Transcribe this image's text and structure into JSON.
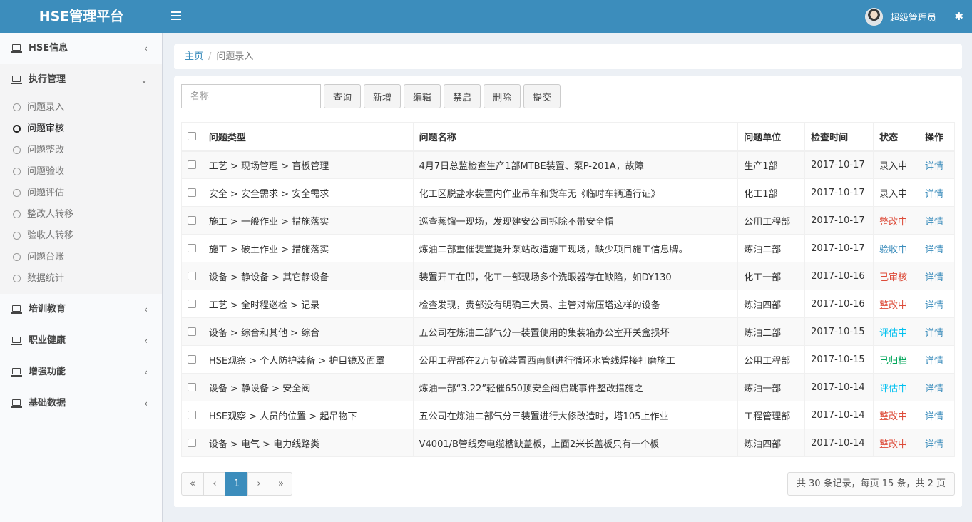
{
  "header": {
    "logo": "HSE管理平台",
    "user_name": "超级管理员"
  },
  "sidebar": {
    "items": [
      {
        "label": "HSE信息",
        "arrow": "‹"
      },
      {
        "label": "执行管理",
        "arrow": "⌄"
      },
      {
        "label": "培训教育",
        "arrow": "‹"
      },
      {
        "label": "职业健康",
        "arrow": "‹"
      },
      {
        "label": "增强功能",
        "arrow": "‹"
      },
      {
        "label": "基础数据",
        "arrow": "‹"
      }
    ],
    "submenu": [
      "问题录入",
      "问题审核",
      "问题整改",
      "问题验收",
      "问题评估",
      "整改人转移",
      "验收人转移",
      "问题台账",
      "数据统计"
    ]
  },
  "breadcrumb": {
    "home": "主页",
    "separator": "/",
    "current": "问题录入"
  },
  "toolbar": {
    "search_placeholder": "名称",
    "buttons": [
      "查询",
      "新增",
      "编辑",
      "禁启",
      "删除",
      "提交"
    ]
  },
  "table": {
    "columns": [
      "问题类型",
      "问题名称",
      "问题单位",
      "检查时间",
      "状态",
      "操作"
    ],
    "rows": [
      {
        "type": "工艺 > 现场管理 > 盲板管理",
        "name": "4月7日总监检查生产1部MTBE装置、泵P-201A，故障",
        "unit": "生产1部",
        "date": "2017-10-17",
        "status": "录入中",
        "status_color": "#333333",
        "action": "详情"
      },
      {
        "type": "安全 > 安全需求 > 安全需求",
        "name": "化工区脱盐水装置内作业吊车和货车无《临时车辆通行证》",
        "unit": "化工1部",
        "date": "2017-10-17",
        "status": "录入中",
        "status_color": "#333333",
        "action": "详情"
      },
      {
        "type": "施工 > 一般作业 > 措施落实",
        "name": "巡查蒸馏一现场，发现建安公司拆除不带安全帽",
        "unit": "公用工程部",
        "date": "2017-10-17",
        "status": "整改中",
        "status_color": "#dd4b39",
        "action": "详情"
      },
      {
        "type": "施工 > 破土作业 > 措施落实",
        "name": "炼油二部重催装置提升泵站改造施工现场，缺少项目施工信息牌。",
        "unit": "炼油二部",
        "date": "2017-10-17",
        "status": "验收中",
        "status_color": "#3c8dbc",
        "action": "详情"
      },
      {
        "type": "设备 > 静设备 > 其它静设备",
        "name": "装置开工在即，化工一部现场多个洗眼器存在缺陷，如DY130",
        "unit": "化工一部",
        "date": "2017-10-16",
        "status": "已审核",
        "status_color": "#dd4b39",
        "action": "详情"
      },
      {
        "type": "工艺 > 全时程巡检 > 记录",
        "name": "检查发现，贵部没有明确三大员、主管对常压塔这样的设备",
        "unit": "炼油四部",
        "date": "2017-10-16",
        "status": "整改中",
        "status_color": "#dd4b39",
        "action": "详情"
      },
      {
        "type": "设备 > 综合和其他 > 综合",
        "name": "五公司在炼油二部气分一装置使用的集装箱办公室开关盒损坏",
        "unit": "炼油二部",
        "date": "2017-10-15",
        "status": "评估中",
        "status_color": "#00c0ef",
        "action": "详情"
      },
      {
        "type": "HSE观察 > 个人防护装备 > 护目镜及面罩",
        "name": "公用工程部在2万制硫装置西南侧进行循环水管线焊接打磨施工",
        "unit": "公用工程部",
        "date": "2017-10-15",
        "status": "已归档",
        "status_color": "#00a65a",
        "action": "详情"
      },
      {
        "type": "设备 > 静设备 > 安全阀",
        "name": "炼油一部“3.22”轻催650顶安全阀启跳事件整改措施之",
        "unit": "炼油一部",
        "date": "2017-10-14",
        "status": "评估中",
        "status_color": "#00c0ef",
        "action": "详情"
      },
      {
        "type": "HSE观察 > 人员的位置 > 起吊物下",
        "name": "五公司在炼油二部气分三装置进行大修改造时，塔105上作业",
        "unit": "工程管理部",
        "date": "2017-10-14",
        "status": "整改中",
        "status_color": "#dd4b39",
        "action": "详情"
      },
      {
        "type": "设备 > 电气 > 电力线路类",
        "name": "V4001/B管线旁电缆槽缺盖板，上面2米长盖板只有一个板",
        "unit": "炼油四部",
        "date": "2017-10-14",
        "status": "整改中",
        "status_color": "#dd4b39",
        "action": "详情"
      }
    ]
  },
  "pagination": {
    "first": "«",
    "prev": "‹",
    "current": "1",
    "next": "›",
    "last": "»",
    "info": "共 30 条记录，每页 15 条，共 2 页"
  },
  "colors": {
    "header_bg": "#3c8dbc",
    "accent": "#3c8dbc",
    "page_bg": "#ecf0f5"
  }
}
